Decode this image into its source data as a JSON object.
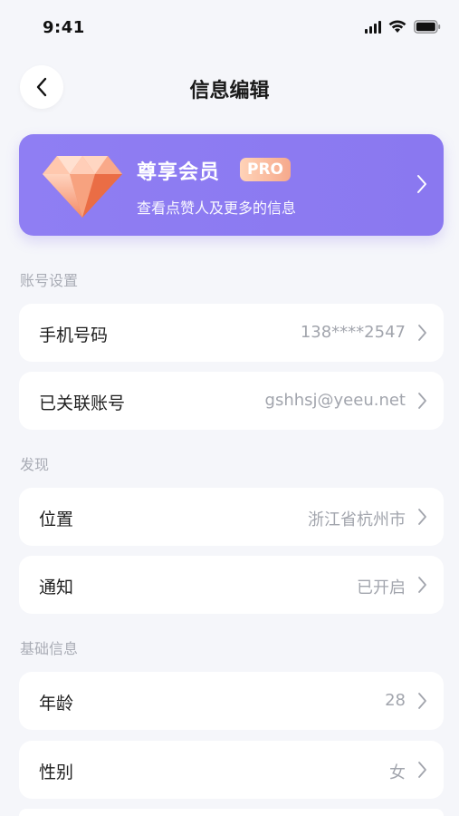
{
  "status_bar": {
    "time": "9:41"
  },
  "header": {
    "title": "信息编辑"
  },
  "vip_card": {
    "title": "尊享会员",
    "badge": "PRO",
    "subtitle": "查看点赞人及更多的信息"
  },
  "sections": [
    {
      "label": "账号设置",
      "rows": [
        {
          "label": "手机号码",
          "value": "138****2547"
        },
        {
          "label": "已关联账号",
          "value": "gshhsj@yeeu.net"
        }
      ]
    },
    {
      "label": "发现",
      "rows": [
        {
          "label": "位置",
          "value": "浙江省杭州市"
        },
        {
          "label": "通知",
          "value": "已开启"
        }
      ]
    },
    {
      "label": "基础信息",
      "rows": [
        {
          "label": "年龄",
          "value": "28"
        },
        {
          "label": "性别",
          "value": "女"
        }
      ]
    }
  ],
  "colors": {
    "background": "#f5f6fa",
    "vip_card": "#8a78f0",
    "pro_badge": "#f6a98c",
    "secondary_text": "#a2a5ad"
  },
  "icons": {
    "back": "chevron-left-icon",
    "gem": "diamond-icon",
    "row_arrow": "chevron-right-icon"
  }
}
